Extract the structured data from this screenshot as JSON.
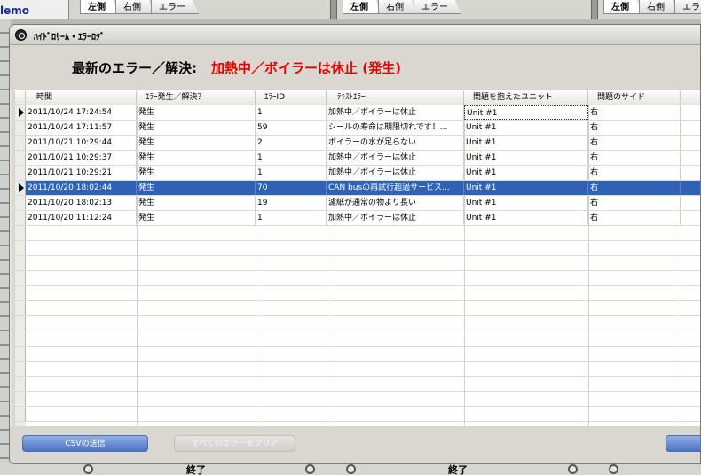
{
  "background": {
    "memo_label": "lemo",
    "tabsets": [
      {
        "tabs": [
          "左側",
          "右側",
          "エラー"
        ]
      },
      {
        "tabs": [
          "左側",
          "右側",
          "エラー"
        ]
      },
      {
        "tabs": [
          "左側",
          "右側",
          "エラー"
        ]
      }
    ],
    "bottom_labels": [
      "終了",
      "終了"
    ]
  },
  "dialog": {
    "title": "ﾊｲﾄﾞﾛｻｰﾑ・ｴﾗｰﾛｸﾞ",
    "latest_label": "最新のエラー／解決:",
    "latest_value": "加熱中／ボイラーは休止 (発生)"
  },
  "table": {
    "columns": [
      "時間",
      "ｴﾗｰ発生／解決？",
      "ｴﾗｰID",
      "ﾃｷｽﾄｴﾗｰ",
      "問題を抱えたユニット",
      "問題のサイド"
    ],
    "rows": [
      {
        "time": "2011/10/24 17:24:54",
        "event": "発生",
        "id": "1",
        "text": "加熱中／ボイラーは休止",
        "unit": "Unit #1",
        "side": "右"
      },
      {
        "time": "2011/10/24 17:11:57",
        "event": "発生",
        "id": "59",
        "text": "シールの寿命は期限切れです！...",
        "unit": "Unit #1",
        "side": "右"
      },
      {
        "time": "2011/10/21 10:29:44",
        "event": "発生",
        "id": "2",
        "text": "ボイラーの水が足らない",
        "unit": "Unit #1",
        "side": "右"
      },
      {
        "time": "2011/10/21 10:29:37",
        "event": "発生",
        "id": "1",
        "text": "加熱中／ボイラーは休止",
        "unit": "Unit #1",
        "side": "右"
      },
      {
        "time": "2011/10/21 10:29:21",
        "event": "発生",
        "id": "1",
        "text": "加熱中／ボイラーは休止",
        "unit": "Unit #1",
        "side": "右"
      },
      {
        "time": "2011/10/20 18:02:44",
        "event": "発生",
        "id": "70",
        "text": "CAN busの再試行超過サービス...",
        "unit": "Unit #1",
        "side": "右"
      },
      {
        "time": "2011/10/20 18:02:13",
        "event": "発生",
        "id": "19",
        "text": "濾紙が通常の物より長い",
        "unit": "Unit #1",
        "side": "右"
      },
      {
        "time": "2011/10/20 11:12:24",
        "event": "発生",
        "id": "1",
        "text": "加熱中／ボイラーは休止",
        "unit": "Unit #1",
        "side": "右"
      }
    ],
    "selected_row_index": 5,
    "empty_row_count": 13
  },
  "buttons": {
    "csv": "CSVの送信",
    "clear_all": "すべてのエラーをクリア"
  },
  "colors": {
    "selection": "#2f62b4",
    "latest_value": "#e00000",
    "button_blue": "#4a73c3"
  }
}
